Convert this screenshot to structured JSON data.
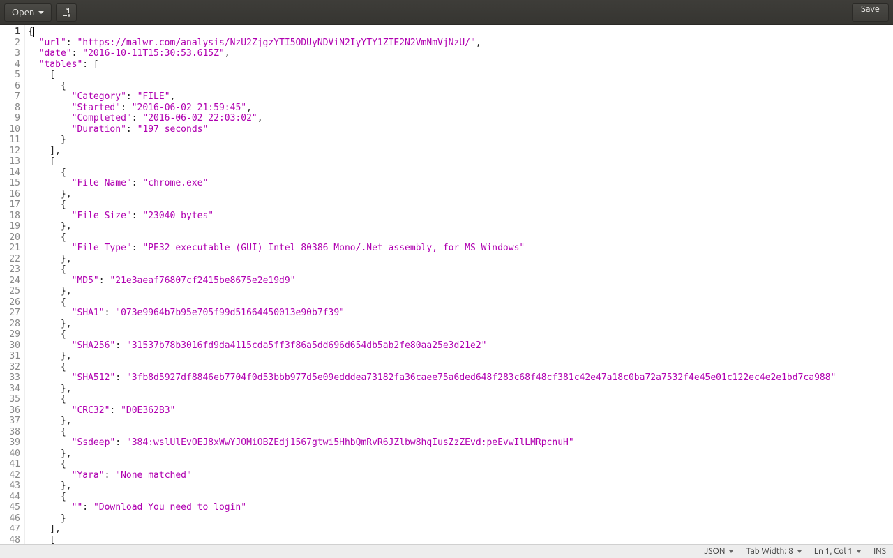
{
  "toolbar": {
    "open_label": "Open",
    "save_label": "Save"
  },
  "statusbar": {
    "language": "JSON",
    "tab_width_label": "Tab Width: 8",
    "cursor_pos": "Ln 1, Col 1",
    "insert_mode": "INS"
  },
  "code": {
    "lines": [
      [
        [
          "p",
          "{"
        ],
        [
          "cursor",
          ""
        ]
      ],
      [
        [
          "p",
          "  "
        ],
        [
          "k",
          "\"url\""
        ],
        [
          "p",
          ": "
        ],
        [
          "s",
          "\"https://malwr.com/analysis/NzU2ZjgzYTI5ODUyNDViN2IyYTY1ZTE2N2VmNmVjNzU/\""
        ],
        [
          "p",
          ","
        ]
      ],
      [
        [
          "p",
          "  "
        ],
        [
          "k",
          "\"date\""
        ],
        [
          "p",
          ": "
        ],
        [
          "s",
          "\"2016-10-11T15:30:53.615Z\""
        ],
        [
          "p",
          ","
        ]
      ],
      [
        [
          "p",
          "  "
        ],
        [
          "k",
          "\"tables\""
        ],
        [
          "p",
          ": ["
        ]
      ],
      [
        [
          "p",
          "    ["
        ]
      ],
      [
        [
          "p",
          "      {"
        ]
      ],
      [
        [
          "p",
          "        "
        ],
        [
          "k",
          "\"Category\""
        ],
        [
          "p",
          ": "
        ],
        [
          "s",
          "\"FILE\""
        ],
        [
          "p",
          ","
        ]
      ],
      [
        [
          "p",
          "        "
        ],
        [
          "k",
          "\"Started\""
        ],
        [
          "p",
          ": "
        ],
        [
          "s",
          "\"2016-06-02 21:59:45\""
        ],
        [
          "p",
          ","
        ]
      ],
      [
        [
          "p",
          "        "
        ],
        [
          "k",
          "\"Completed\""
        ],
        [
          "p",
          ": "
        ],
        [
          "s",
          "\"2016-06-02 22:03:02\""
        ],
        [
          "p",
          ","
        ]
      ],
      [
        [
          "p",
          "        "
        ],
        [
          "k",
          "\"Duration\""
        ],
        [
          "p",
          ": "
        ],
        [
          "s",
          "\"197 seconds\""
        ]
      ],
      [
        [
          "p",
          "      }"
        ]
      ],
      [
        [
          "p",
          "    ],"
        ]
      ],
      [
        [
          "p",
          "    ["
        ]
      ],
      [
        [
          "p",
          "      {"
        ]
      ],
      [
        [
          "p",
          "        "
        ],
        [
          "k",
          "\"File Name\""
        ],
        [
          "p",
          ": "
        ],
        [
          "s",
          "\"chrome.exe\""
        ]
      ],
      [
        [
          "p",
          "      },"
        ]
      ],
      [
        [
          "p",
          "      {"
        ]
      ],
      [
        [
          "p",
          "        "
        ],
        [
          "k",
          "\"File Size\""
        ],
        [
          "p",
          ": "
        ],
        [
          "s",
          "\"23040 bytes\""
        ]
      ],
      [
        [
          "p",
          "      },"
        ]
      ],
      [
        [
          "p",
          "      {"
        ]
      ],
      [
        [
          "p",
          "        "
        ],
        [
          "k",
          "\"File Type\""
        ],
        [
          "p",
          ": "
        ],
        [
          "s",
          "\"PE32 executable (GUI) Intel 80386 Mono/.Net assembly, for MS Windows\""
        ]
      ],
      [
        [
          "p",
          "      },"
        ]
      ],
      [
        [
          "p",
          "      {"
        ]
      ],
      [
        [
          "p",
          "        "
        ],
        [
          "k",
          "\"MD5\""
        ],
        [
          "p",
          ": "
        ],
        [
          "s",
          "\"21e3aeaf76807cf2415be8675e2e19d9\""
        ]
      ],
      [
        [
          "p",
          "      },"
        ]
      ],
      [
        [
          "p",
          "      {"
        ]
      ],
      [
        [
          "p",
          "        "
        ],
        [
          "k",
          "\"SHA1\""
        ],
        [
          "p",
          ": "
        ],
        [
          "s",
          "\"073e9964b7b95e705f99d51664450013e90b7f39\""
        ]
      ],
      [
        [
          "p",
          "      },"
        ]
      ],
      [
        [
          "p",
          "      {"
        ]
      ],
      [
        [
          "p",
          "        "
        ],
        [
          "k",
          "\"SHA256\""
        ],
        [
          "p",
          ": "
        ],
        [
          "s",
          "\"31537b78b3016fd9da4115cda5ff3f86a5dd696d654db5ab2fe80aa25e3d21e2\""
        ]
      ],
      [
        [
          "p",
          "      },"
        ]
      ],
      [
        [
          "p",
          "      {"
        ]
      ],
      [
        [
          "p",
          "        "
        ],
        [
          "k",
          "\"SHA512\""
        ],
        [
          "p",
          ": "
        ],
        [
          "s",
          "\"3fb8d5927df8846eb7704f0d53bbb977d5e09edddea73182fa36caee75a6ded648f283c68f48cf381c42e47a18c0ba72a7532f4e45e01c122ec4e2e1bd7ca988\""
        ]
      ],
      [
        [
          "p",
          "      },"
        ]
      ],
      [
        [
          "p",
          "      {"
        ]
      ],
      [
        [
          "p",
          "        "
        ],
        [
          "k",
          "\"CRC32\""
        ],
        [
          "p",
          ": "
        ],
        [
          "s",
          "\"D0E362B3\""
        ]
      ],
      [
        [
          "p",
          "      },"
        ]
      ],
      [
        [
          "p",
          "      {"
        ]
      ],
      [
        [
          "p",
          "        "
        ],
        [
          "k",
          "\"Ssdeep\""
        ],
        [
          "p",
          ": "
        ],
        [
          "s",
          "\"384:wslUlEvOEJ8xWwYJOMiOBZEdj1567gtwi5HhbQmRvR6JZlbw8hqIusZzZEvd:peEvwIlLMRpcnuH\""
        ]
      ],
      [
        [
          "p",
          "      },"
        ]
      ],
      [
        [
          "p",
          "      {"
        ]
      ],
      [
        [
          "p",
          "        "
        ],
        [
          "k",
          "\"Yara\""
        ],
        [
          "p",
          ": "
        ],
        [
          "s",
          "\"None matched\""
        ]
      ],
      [
        [
          "p",
          "      },"
        ]
      ],
      [
        [
          "p",
          "      {"
        ]
      ],
      [
        [
          "p",
          "        "
        ],
        [
          "k",
          "\"\""
        ],
        [
          "p",
          ": "
        ],
        [
          "s",
          "\"Download You need to login\""
        ]
      ],
      [
        [
          "p",
          "      }"
        ]
      ],
      [
        [
          "p",
          "    ],"
        ]
      ],
      [
        [
          "p",
          "    ["
        ]
      ]
    ]
  }
}
